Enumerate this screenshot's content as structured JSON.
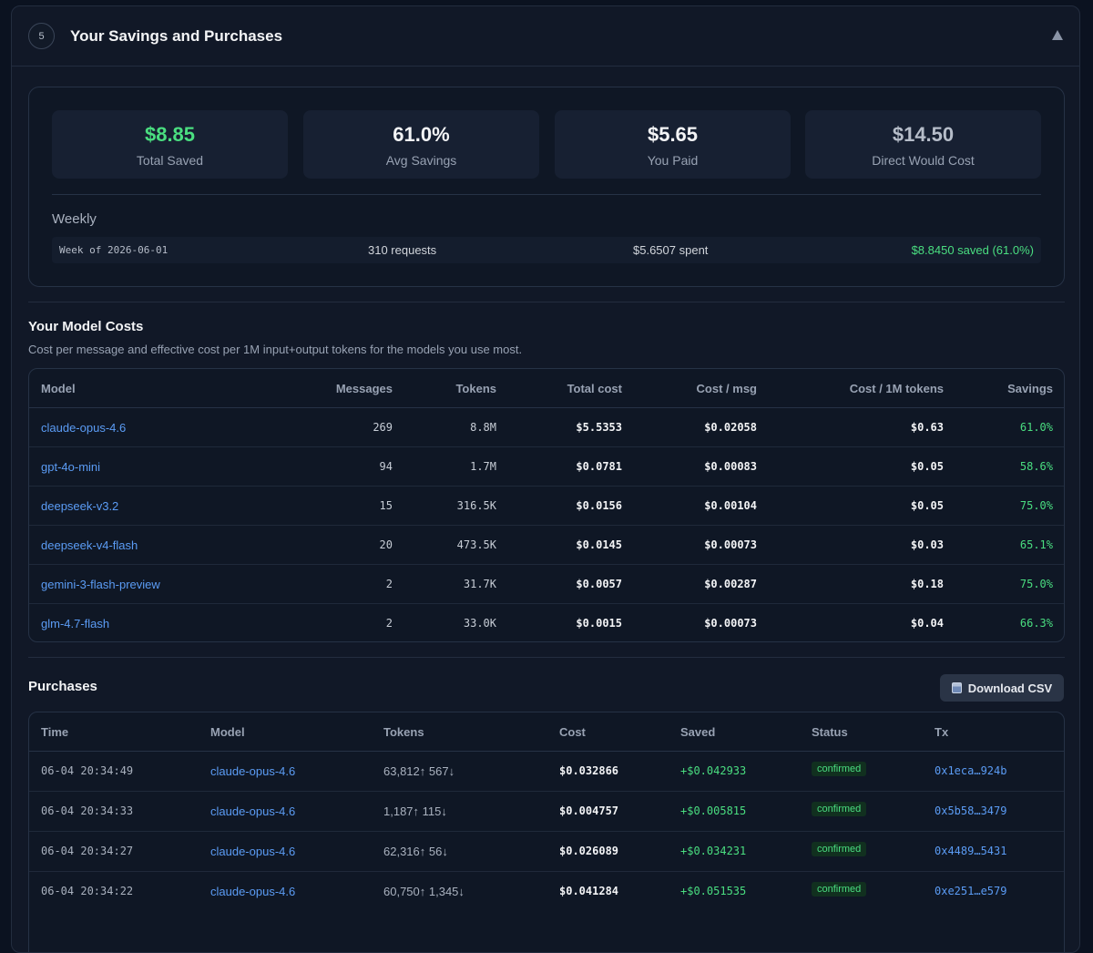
{
  "header": {
    "step": "5",
    "title": "Your Savings and Purchases"
  },
  "summary": {
    "stats": [
      {
        "value": "$8.85",
        "label": "Total Saved",
        "color": "#4ade80"
      },
      {
        "value": "61.0%",
        "label": "Avg Savings",
        "color": "#f3f4f6"
      },
      {
        "value": "$5.65",
        "label": "You Paid",
        "color": "#f3f4f6"
      },
      {
        "value": "$14.50",
        "label": "Direct Would Cost",
        "color": "#b6bdc9"
      }
    ],
    "weekly_label": "Weekly",
    "weekly": {
      "week": "Week of 2026-06-01",
      "requests": "310 requests",
      "spent": "$5.6507 spent",
      "saved": "$8.8450 saved (61.0%)"
    }
  },
  "model_costs": {
    "title": "Your Model Costs",
    "subtitle": "Cost per message and effective cost per 1M input+output tokens for the models you use most.",
    "columns": [
      "Model",
      "Messages",
      "Tokens",
      "Total cost",
      "Cost / msg",
      "Cost / 1M tokens",
      "Savings"
    ],
    "rows": [
      {
        "model": "claude-opus-4.6",
        "messages": "269",
        "tokens": "8.8M",
        "total": "$5.5353",
        "per_msg": "$0.02058",
        "per_1m": "$0.63",
        "savings": "61.0%"
      },
      {
        "model": "gpt-4o-mini",
        "messages": "94",
        "tokens": "1.7M",
        "total": "$0.0781",
        "per_msg": "$0.00083",
        "per_1m": "$0.05",
        "savings": "58.6%"
      },
      {
        "model": "deepseek-v3.2",
        "messages": "15",
        "tokens": "316.5K",
        "total": "$0.0156",
        "per_msg": "$0.00104",
        "per_1m": "$0.05",
        "savings": "75.0%"
      },
      {
        "model": "deepseek-v4-flash",
        "messages": "20",
        "tokens": "473.5K",
        "total": "$0.0145",
        "per_msg": "$0.00073",
        "per_1m": "$0.03",
        "savings": "65.1%"
      },
      {
        "model": "gemini-3-flash-preview",
        "messages": "2",
        "tokens": "31.7K",
        "total": "$0.0057",
        "per_msg": "$0.00287",
        "per_1m": "$0.18",
        "savings": "75.0%"
      },
      {
        "model": "glm-4.7-flash",
        "messages": "2",
        "tokens": "33.0K",
        "total": "$0.0015",
        "per_msg": "$0.00073",
        "per_1m": "$0.04",
        "savings": "66.3%"
      }
    ]
  },
  "purchases": {
    "title": "Purchases",
    "download_label": "Download CSV",
    "columns": [
      "Time",
      "Model",
      "Tokens",
      "Cost",
      "Saved",
      "Status",
      "Tx"
    ],
    "rows": [
      {
        "time": "06-04 20:34:49",
        "model": "claude-opus-4.6",
        "tokens": "63,812↑ 567↓",
        "cost": "$0.032866",
        "saved": "+$0.042933",
        "status": "confirmed",
        "tx": "0x1eca…924b"
      },
      {
        "time": "06-04 20:34:33",
        "model": "claude-opus-4.6",
        "tokens": "1,187↑ 115↓",
        "cost": "$0.004757",
        "saved": "+$0.005815",
        "status": "confirmed",
        "tx": "0x5b58…3479"
      },
      {
        "time": "06-04 20:34:27",
        "model": "claude-opus-4.6",
        "tokens": "62,316↑ 56↓",
        "cost": "$0.026089",
        "saved": "+$0.034231",
        "status": "confirmed",
        "tx": "0x4489…5431"
      },
      {
        "time": "06-04 20:34:22",
        "model": "claude-opus-4.6",
        "tokens": "60,750↑ 1,345↓",
        "cost": "$0.041284",
        "saved": "+$0.051535",
        "status": "confirmed",
        "tx": "0xe251…e579"
      }
    ]
  }
}
